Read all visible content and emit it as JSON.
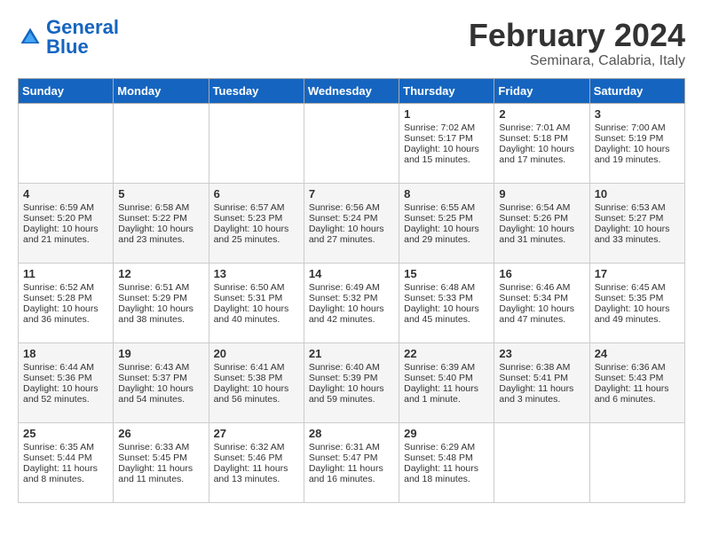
{
  "logo": {
    "part1": "General",
    "part2": "Blue"
  },
  "title": "February 2024",
  "subtitle": "Seminara, Calabria, Italy",
  "days_of_week": [
    "Sunday",
    "Monday",
    "Tuesday",
    "Wednesday",
    "Thursday",
    "Friday",
    "Saturday"
  ],
  "weeks": [
    [
      {
        "day": "",
        "info": ""
      },
      {
        "day": "",
        "info": ""
      },
      {
        "day": "",
        "info": ""
      },
      {
        "day": "",
        "info": ""
      },
      {
        "day": "1",
        "info": "Sunrise: 7:02 AM\nSunset: 5:17 PM\nDaylight: 10 hours\nand 15 minutes."
      },
      {
        "day": "2",
        "info": "Sunrise: 7:01 AM\nSunset: 5:18 PM\nDaylight: 10 hours\nand 17 minutes."
      },
      {
        "day": "3",
        "info": "Sunrise: 7:00 AM\nSunset: 5:19 PM\nDaylight: 10 hours\nand 19 minutes."
      }
    ],
    [
      {
        "day": "4",
        "info": "Sunrise: 6:59 AM\nSunset: 5:20 PM\nDaylight: 10 hours\nand 21 minutes."
      },
      {
        "day": "5",
        "info": "Sunrise: 6:58 AM\nSunset: 5:22 PM\nDaylight: 10 hours\nand 23 minutes."
      },
      {
        "day": "6",
        "info": "Sunrise: 6:57 AM\nSunset: 5:23 PM\nDaylight: 10 hours\nand 25 minutes."
      },
      {
        "day": "7",
        "info": "Sunrise: 6:56 AM\nSunset: 5:24 PM\nDaylight: 10 hours\nand 27 minutes."
      },
      {
        "day": "8",
        "info": "Sunrise: 6:55 AM\nSunset: 5:25 PM\nDaylight: 10 hours\nand 29 minutes."
      },
      {
        "day": "9",
        "info": "Sunrise: 6:54 AM\nSunset: 5:26 PM\nDaylight: 10 hours\nand 31 minutes."
      },
      {
        "day": "10",
        "info": "Sunrise: 6:53 AM\nSunset: 5:27 PM\nDaylight: 10 hours\nand 33 minutes."
      }
    ],
    [
      {
        "day": "11",
        "info": "Sunrise: 6:52 AM\nSunset: 5:28 PM\nDaylight: 10 hours\nand 36 minutes."
      },
      {
        "day": "12",
        "info": "Sunrise: 6:51 AM\nSunset: 5:29 PM\nDaylight: 10 hours\nand 38 minutes."
      },
      {
        "day": "13",
        "info": "Sunrise: 6:50 AM\nSunset: 5:31 PM\nDaylight: 10 hours\nand 40 minutes."
      },
      {
        "day": "14",
        "info": "Sunrise: 6:49 AM\nSunset: 5:32 PM\nDaylight: 10 hours\nand 42 minutes."
      },
      {
        "day": "15",
        "info": "Sunrise: 6:48 AM\nSunset: 5:33 PM\nDaylight: 10 hours\nand 45 minutes."
      },
      {
        "day": "16",
        "info": "Sunrise: 6:46 AM\nSunset: 5:34 PM\nDaylight: 10 hours\nand 47 minutes."
      },
      {
        "day": "17",
        "info": "Sunrise: 6:45 AM\nSunset: 5:35 PM\nDaylight: 10 hours\nand 49 minutes."
      }
    ],
    [
      {
        "day": "18",
        "info": "Sunrise: 6:44 AM\nSunset: 5:36 PM\nDaylight: 10 hours\nand 52 minutes."
      },
      {
        "day": "19",
        "info": "Sunrise: 6:43 AM\nSunset: 5:37 PM\nDaylight: 10 hours\nand 54 minutes."
      },
      {
        "day": "20",
        "info": "Sunrise: 6:41 AM\nSunset: 5:38 PM\nDaylight: 10 hours\nand 56 minutes."
      },
      {
        "day": "21",
        "info": "Sunrise: 6:40 AM\nSunset: 5:39 PM\nDaylight: 10 hours\nand 59 minutes."
      },
      {
        "day": "22",
        "info": "Sunrise: 6:39 AM\nSunset: 5:40 PM\nDaylight: 11 hours\nand 1 minute."
      },
      {
        "day": "23",
        "info": "Sunrise: 6:38 AM\nSunset: 5:41 PM\nDaylight: 11 hours\nand 3 minutes."
      },
      {
        "day": "24",
        "info": "Sunrise: 6:36 AM\nSunset: 5:43 PM\nDaylight: 11 hours\nand 6 minutes."
      }
    ],
    [
      {
        "day": "25",
        "info": "Sunrise: 6:35 AM\nSunset: 5:44 PM\nDaylight: 11 hours\nand 8 minutes."
      },
      {
        "day": "26",
        "info": "Sunrise: 6:33 AM\nSunset: 5:45 PM\nDaylight: 11 hours\nand 11 minutes."
      },
      {
        "day": "27",
        "info": "Sunrise: 6:32 AM\nSunset: 5:46 PM\nDaylight: 11 hours\nand 13 minutes."
      },
      {
        "day": "28",
        "info": "Sunrise: 6:31 AM\nSunset: 5:47 PM\nDaylight: 11 hours\nand 16 minutes."
      },
      {
        "day": "29",
        "info": "Sunrise: 6:29 AM\nSunset: 5:48 PM\nDaylight: 11 hours\nand 18 minutes."
      },
      {
        "day": "",
        "info": ""
      },
      {
        "day": "",
        "info": ""
      }
    ]
  ]
}
